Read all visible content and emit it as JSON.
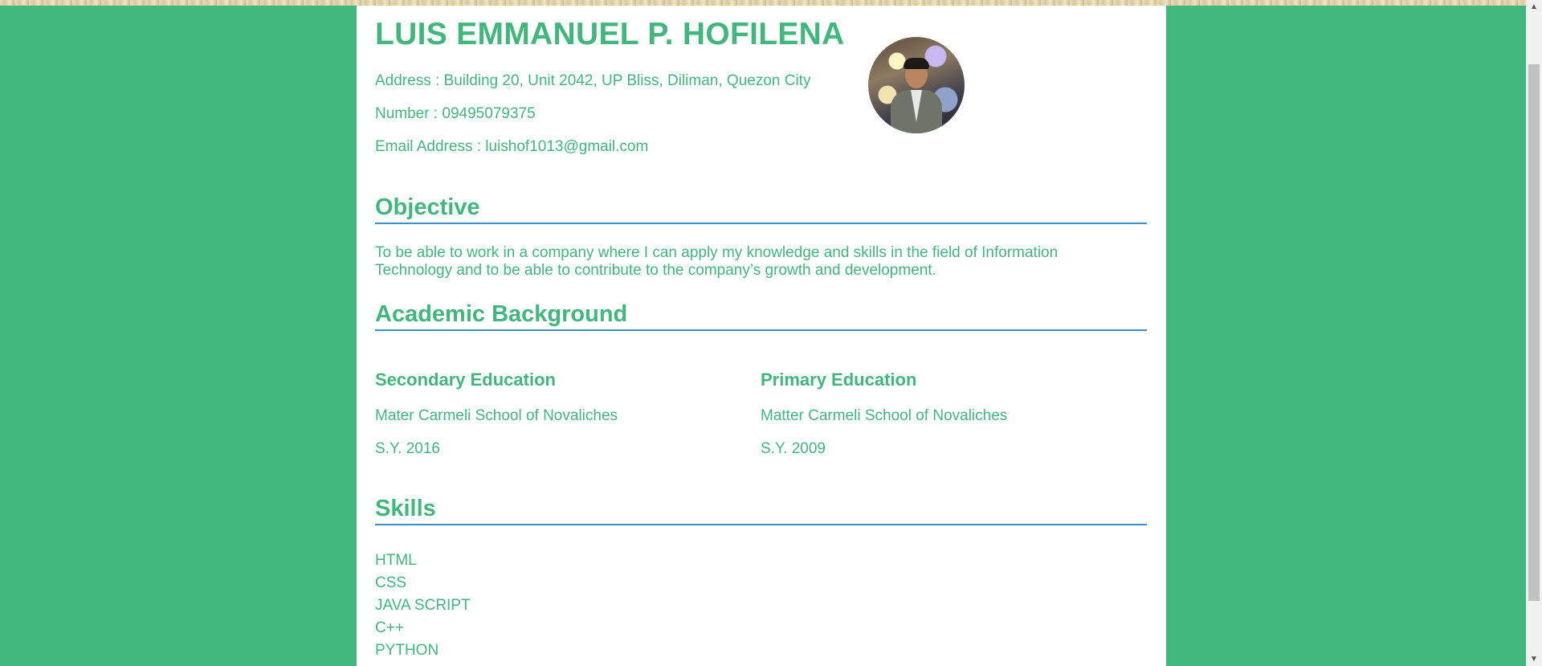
{
  "resume": {
    "name": "LUIS EMMANUEL P. HOFILENA",
    "address": "Address : Building 20, Unit 2042, UP Bliss, Diliman, Quezon City",
    "number": "Number : 09495079375",
    "email": "Email Address : luishof1013@gmail.com",
    "objective": {
      "title": "Objective",
      "text": "To be able to work in a company where I can apply my knowledge and skills in the field of Information Technology and to be able to contribute to the company’s growth and development."
    },
    "academic": {
      "title": "Academic Background",
      "secondary": {
        "title": "Secondary Education",
        "school": "Mater Carmeli School of Novaliches",
        "year": "S.Y. 2016"
      },
      "primary": {
        "title": "Primary Education",
        "school": "Matter Carmeli School of Novaliches",
        "year": "S.Y. 2009"
      }
    },
    "skills": {
      "title": "Skills",
      "items": [
        "HTML",
        "CSS",
        "JAVA SCRIPT",
        "C++",
        "PYTHON"
      ]
    }
  },
  "theme": {
    "background": "#42b77d",
    "text": "#42b77d",
    "rule": "#3b8fd0",
    "paper": "#ffffff"
  },
  "icons": {
    "avatar": "profile-photo",
    "scroll_up": "chevron-up-icon",
    "scroll_down": "chevron-down-icon"
  }
}
